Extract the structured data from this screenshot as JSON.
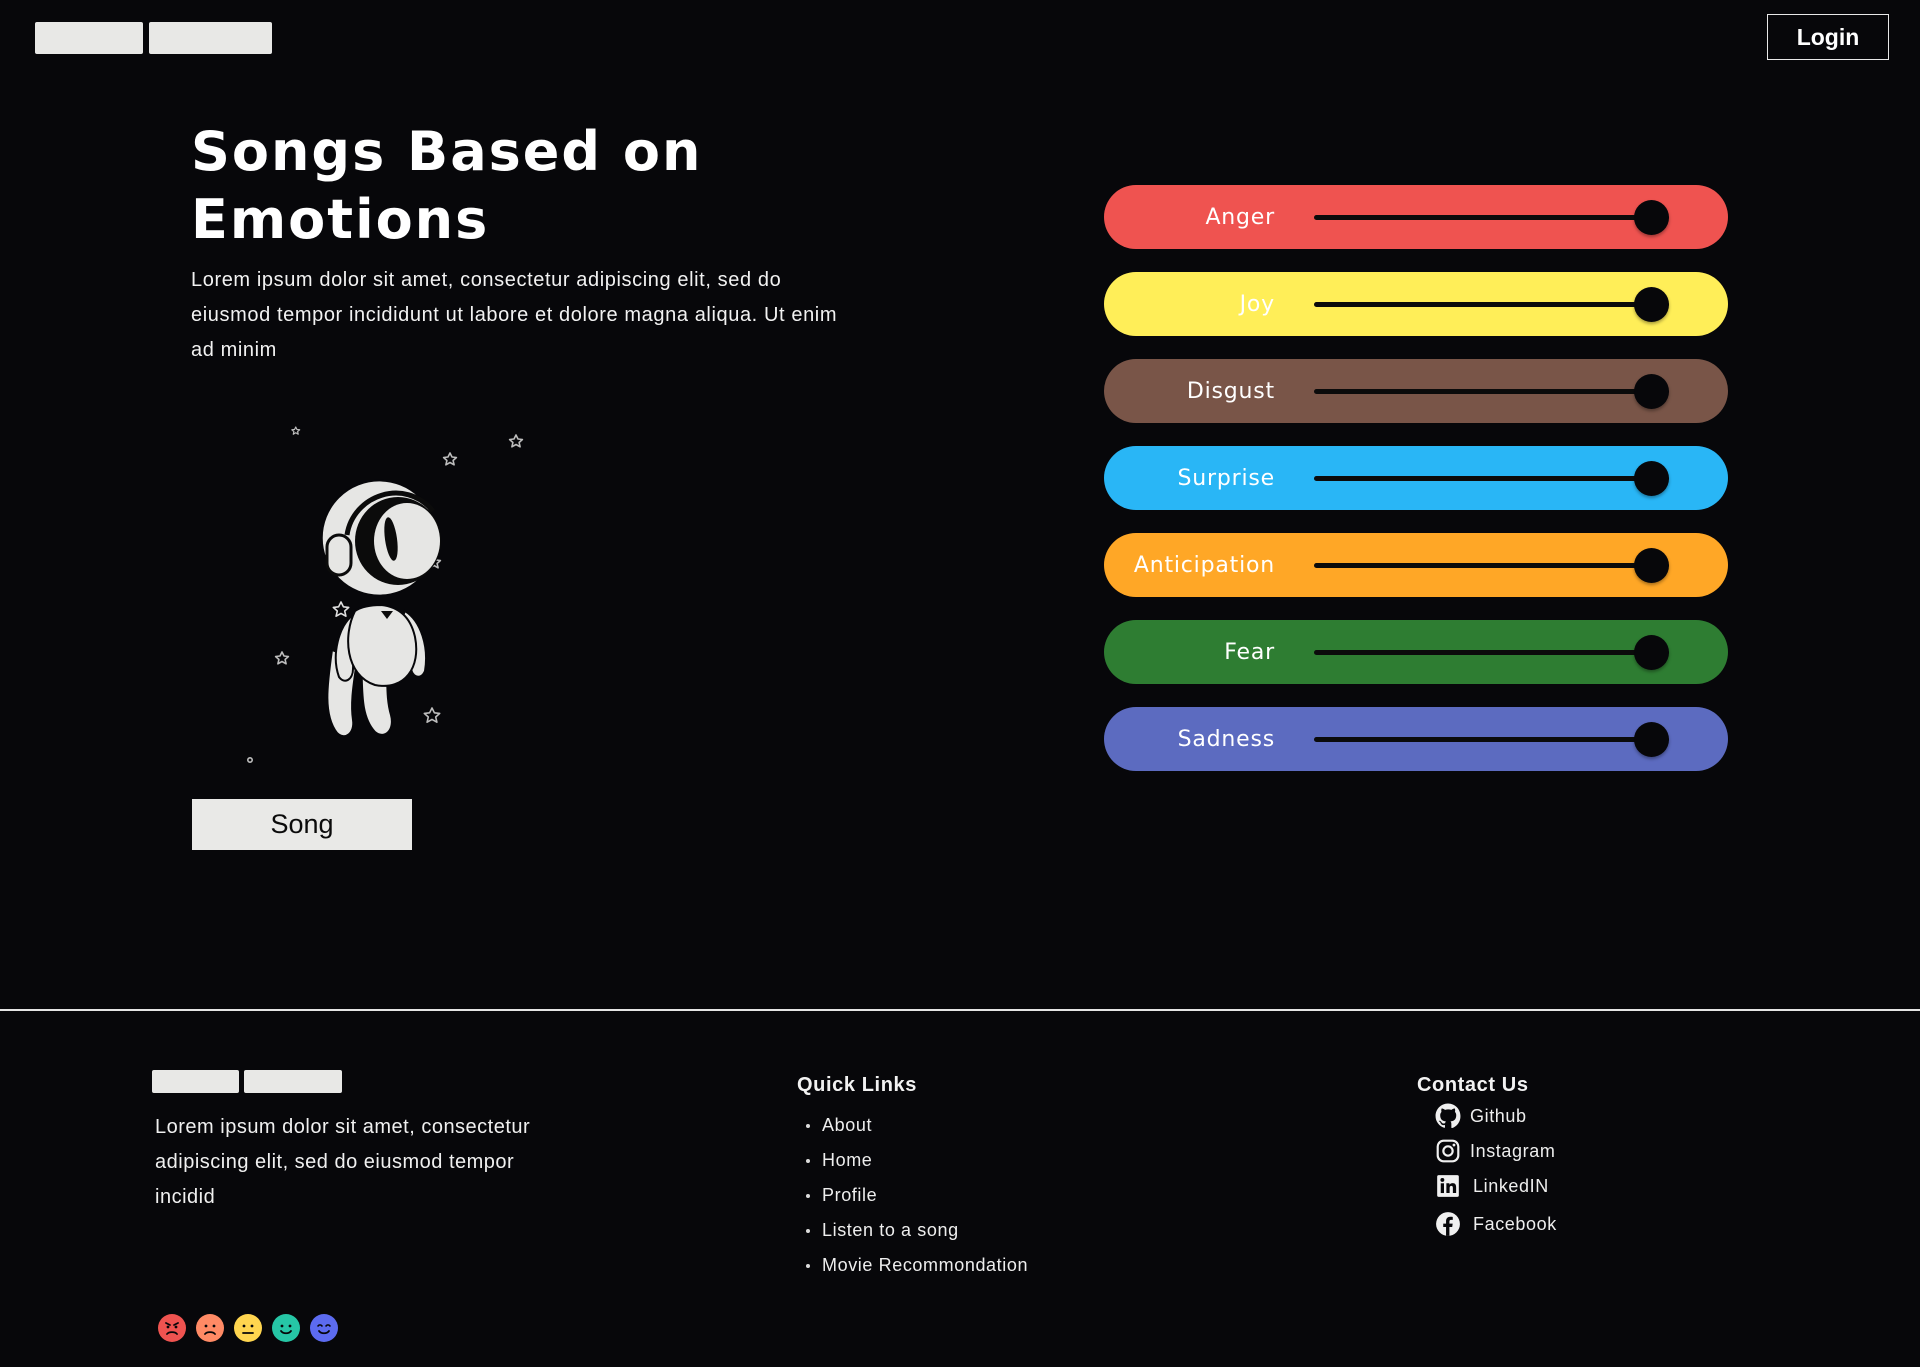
{
  "header": {
    "login_label": "Login"
  },
  "hero": {
    "title": "Songs Based on Emotions",
    "description": "Lorem ipsum dolor sit amet, consectetur adipiscing elit, sed do eiusmod tempor incididunt ut labore et dolore magna aliqua. Ut enim ad minim",
    "song_button_label": "Song"
  },
  "emotions": [
    {
      "label": "Anger",
      "color": "#ef5350",
      "value": 0.95
    },
    {
      "label": "Joy",
      "color": "#ffee58",
      "value": 0.95
    },
    {
      "label": "Disgust",
      "color": "#795548",
      "value": 0.95
    },
    {
      "label": "Surprise",
      "color": "#29b6f6",
      "value": 0.95
    },
    {
      "label": "Anticipation",
      "color": "#ffa726",
      "value": 0.95
    },
    {
      "label": "Fear",
      "color": "#2e7d32",
      "value": 0.95
    },
    {
      "label": "Sadness",
      "color": "#5c6bc0",
      "value": 0.95
    }
  ],
  "footer": {
    "description": "Lorem ipsum dolor sit amet, consectetur adipiscing elit, sed do eiusmod tempor incidid",
    "quick_links_heading": "Quick Links",
    "quick_links": [
      "About",
      "Home",
      "Profile",
      "Listen to a song",
      "Movie Recommondation"
    ],
    "contact_heading": "Contact Us",
    "contacts": [
      {
        "label": "Github",
        "icon": "github-icon"
      },
      {
        "label": "Instagram",
        "icon": "instagram-icon"
      },
      {
        "label": "LinkedIN",
        "icon": "linkedin-icon"
      },
      {
        "label": "Facebook",
        "icon": "facebook-icon"
      }
    ],
    "emoji_colors": [
      "#ef5350",
      "#ff8a65",
      "#ffd54f",
      "#26c6a6",
      "#5c6bf0"
    ]
  }
}
